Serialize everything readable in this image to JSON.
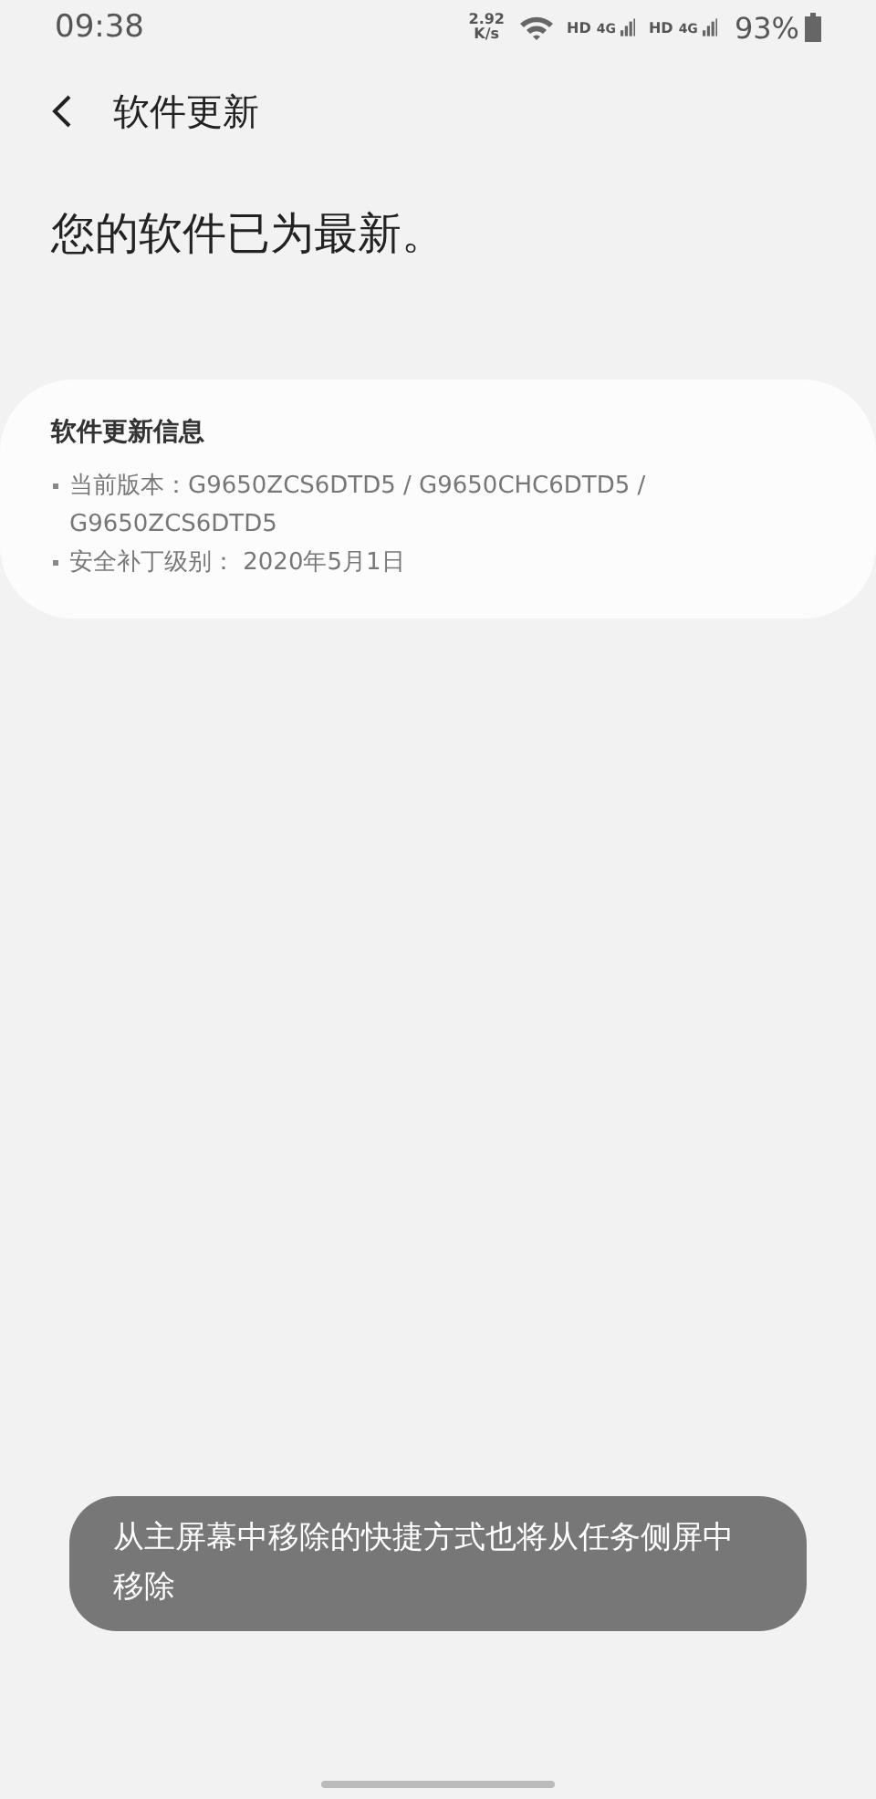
{
  "status_bar": {
    "time": "09:38",
    "net_speed": [
      "2.92",
      "K/s"
    ],
    "sims": [
      {
        "hd": "HD",
        "network": "4G"
      },
      {
        "hd": "HD",
        "network": "4G"
      }
    ],
    "battery": "93%"
  },
  "header": {
    "title": "软件更新"
  },
  "headline": "您的软件已为最新。",
  "info_card": {
    "title": "软件更新信息",
    "items": [
      "当前版本：G9650ZCS6DTD5 / G9650CHC6DTD5 / G9650ZCS6DTD5",
      "安全补丁级别： 2020年5月1日"
    ]
  },
  "toast": "从主屏幕中移除的快捷方式也将从任务侧屏中移除"
}
